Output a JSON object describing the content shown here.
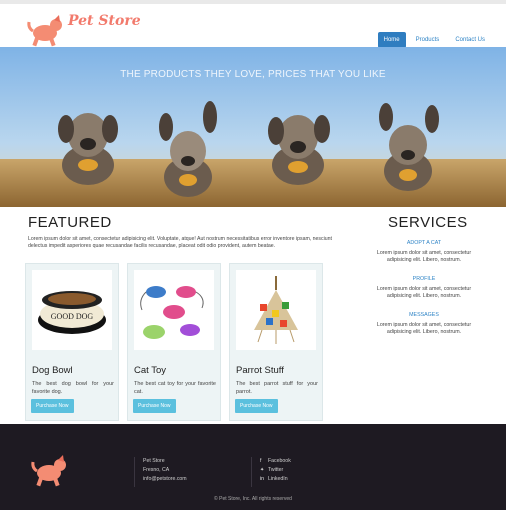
{
  "brand": {
    "name": "Pet Store",
    "color": "#f27a6c"
  },
  "nav": [
    {
      "label": "Home",
      "active": true
    },
    {
      "label": "Products",
      "active": false
    },
    {
      "label": "Contact Us",
      "active": false
    }
  ],
  "hero": {
    "caption": "THE PRODUCTS THEY LOVE, PRICES THAT YOU LIKE"
  },
  "featured": {
    "title": "FEATURED",
    "text": "Lorem ipsum dolor sit amet, consectetur adipisicing elit. Voluptate, atque! Aut nostrum necessitatibus error inventore ipsam, nesciunt delectus impedit asperiores quae recusandae facilis recusandae, placeat odit odio provident, autem beatae.",
    "products": [
      {
        "name": "Dog Bowl",
        "desc": "The best dog bowl for your favorite dog.",
        "button": "Purchase Now",
        "image_text": "GOOD DOG"
      },
      {
        "name": "Cat Toy",
        "desc": "The best cat toy for your favorite cat.",
        "button": "Purchase Now"
      },
      {
        "name": "Parrot Stuff",
        "desc": "The best parrot stuff for your parrot.",
        "button": "Purchase Now"
      }
    ]
  },
  "services": {
    "title": "SERVICES",
    "items": [
      {
        "heading": "ADOPT A CAT",
        "text": "Lorem ipsum dolor sit amet, consectetur adipisicing elit. Libero, nostrum."
      },
      {
        "heading": "PROFILE",
        "text": "Lorem ipsum dolor sit amet, consectetur adipisicing elit. Libero, nostrum."
      },
      {
        "heading": "MESSAGES",
        "text": "Lorem ipsum dolor sit amet, consectetur adipisicing elit. Libero, nostrum."
      }
    ]
  },
  "footer": {
    "company": "Pet Store",
    "city": "Fresno, CA",
    "email": "info@petstore.com",
    "social": [
      {
        "icon": "facebook-icon",
        "glyph": "f",
        "label": "Facebook"
      },
      {
        "icon": "twitter-icon",
        "glyph": "✦",
        "label": "Twitter"
      },
      {
        "icon": "linkedin-icon",
        "glyph": "in",
        "label": "LinkedIn"
      }
    ],
    "copyright": "© Pet Store, Inc. All rights reserved"
  },
  "colors": {
    "nav_active": "#2f7dc0",
    "button": "#5bc0de",
    "footer": "#1e1a22",
    "link": "#2f84c6"
  }
}
